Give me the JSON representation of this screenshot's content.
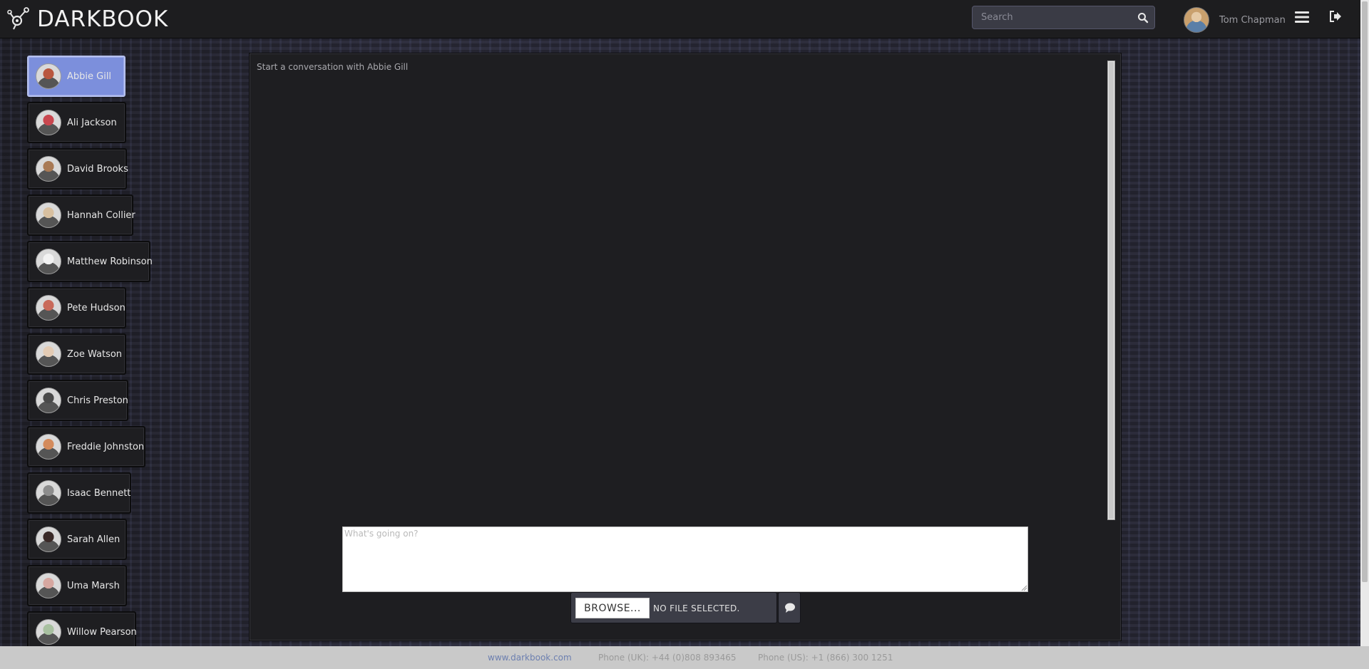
{
  "header": {
    "brand": "DARKBOOK",
    "search_placeholder": "Search",
    "user_name": "Tom Chapman"
  },
  "contacts": [
    {
      "name": "Abbie Gill",
      "active": true,
      "avatar_color": "#b9573f"
    },
    {
      "name": "Ali Jackson",
      "active": false,
      "avatar_color": "#c9474f"
    },
    {
      "name": "David Brooks",
      "active": false,
      "avatar_color": "#a97a55"
    },
    {
      "name": "Hannah Collier",
      "active": false,
      "avatar_color": "#d8c0a0"
    },
    {
      "name": "Matthew Robinson",
      "active": false,
      "avatar_color": "#f2f2f2"
    },
    {
      "name": "Pete Hudson",
      "active": false,
      "avatar_color": "#c96a5a"
    },
    {
      "name": "Zoe Watson",
      "active": false,
      "avatar_color": "#e3cbb4"
    },
    {
      "name": "Chris Preston",
      "active": false,
      "avatar_color": "#4a4a4a"
    },
    {
      "name": "Freddie Johnston",
      "active": false,
      "avatar_color": "#d48b5c"
    },
    {
      "name": "Isaac Bennett",
      "active": false,
      "avatar_color": "#8d8d8d"
    },
    {
      "name": "Sarah Allen",
      "active": false,
      "avatar_color": "#3a2a28"
    },
    {
      "name": "Uma Marsh",
      "active": false,
      "avatar_color": "#d6a7a0"
    },
    {
      "name": "Willow Pearson",
      "active": false,
      "avatar_color": "#a8c0a0"
    }
  ],
  "chat": {
    "intro": "Start a conversation with Abbie Gill",
    "message_placeholder": "What's going on?",
    "browse_label": "BROWSE...",
    "file_status": "NO FILE SELECTED."
  },
  "footer": {
    "website": "www.darkbook.com",
    "phone_uk": "Phone (UK): +44 (0)808 893465",
    "phone_us": "Phone (US): +1 (866) 300 1251"
  },
  "colors": {
    "active_contact": "#7c8fdc",
    "panel_bg": "#1e1e21",
    "header_bg": "#1d1d1f"
  }
}
